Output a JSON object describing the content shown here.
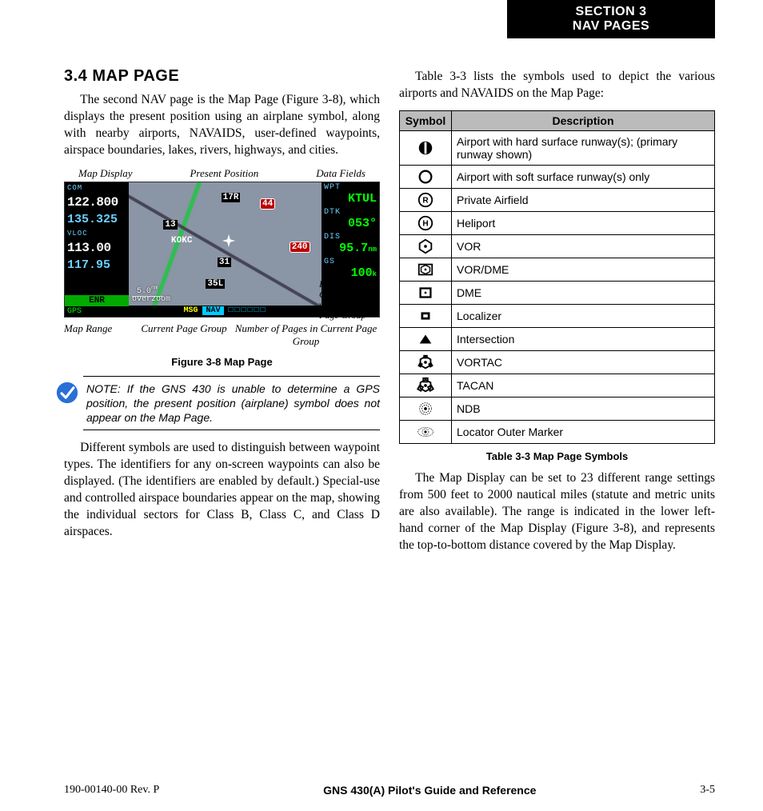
{
  "section_tab": {
    "line1": "SECTION 3",
    "line2": "NAV PAGES"
  },
  "heading": "3.4  MAP PAGE",
  "para1": "The second NAV page is the Map Page (Figure 3-8), which displays the present position using an airplane symbol, along with nearby airports, NAVAIDS, user-defined waypoints, airspace boundaries, lakes, rivers, highways, and cities.",
  "fig": {
    "top_callouts": {
      "c1": "Map Display",
      "c2": "Present Position",
      "c3": "Data Fields"
    },
    "side_callout": "Position of Current Page within Current Page Group",
    "bot_callouts": {
      "c1": "Map Range",
      "c2": "Current Page Group",
      "c3": "Number of Pages in Current Page Group"
    },
    "caption": "Figure 3-8  Map Page",
    "device": {
      "com_label": "COM",
      "com1": "122.800",
      "com2": "135.325",
      "vloc_label": "VLOC",
      "vloc1": "113.00",
      "vloc2": "117.95",
      "enr": "ENR",
      "gps": "GPS",
      "overzoom1": "5.0",
      "overzoom_unit": "nm",
      "overzoom2": "overzoom",
      "map_txt_17R": "17R",
      "map_txt_13": "13",
      "map_txt_KOKC": "KOKC",
      "map_txt_44": "44",
      "map_txt_240": "240",
      "map_txt_31": "31",
      "map_txt_35L": "35L",
      "wpt_label": "WPT",
      "wpt_val": "KTUL",
      "dtk_label": "DTK",
      "dtk_val": "053°",
      "dis_label": "DIS",
      "dis_val": "95.7",
      "dis_unit": "nm",
      "gs_label": "GS",
      "gs_val": "100",
      "gs_unit": "k",
      "msg": "MSG",
      "nav": "NAV",
      "page_boxes": "□□□□□□"
    }
  },
  "note": "NOTE:  If the GNS 430 is unable to determine a GPS position, the present position (airplane) symbol does not appear on the Map Page.",
  "para2": "Different symbols are used to distinguish between waypoint types.  The identifiers for any on-screen waypoints can also be displayed.  (The identifiers are enabled by default.)  Special-use and controlled airspace boundaries appear on the map, showing the individual sectors for Class B, Class C, and Class D airspaces.",
  "para3": "Table 3-3 lists the symbols used to depict the various airports and NAVAIDS on the Map Page:",
  "table": {
    "h1": "Symbol",
    "h2": "Description",
    "rows": [
      "Airport with hard surface runway(s); (primary runway shown)",
      "Airport with soft surface runway(s) only",
      "Private Airfield",
      "Heliport",
      "VOR",
      "VOR/DME",
      "DME",
      "Localizer",
      "Intersection",
      "VORTAC",
      "TACAN",
      "NDB",
      "Locator Outer Marker"
    ],
    "caption": "Table 3-3 Map Page Symbols"
  },
  "para4": "The Map Display can be set to 23 different range settings from 500 feet to 2000 nautical miles (statute and metric units are also available).  The range is indicated in the lower left-hand corner of the Map Display (Figure 3-8), and represents the top-to-bottom distance covered by the Map Display.",
  "footer": {
    "left": "190-00140-00  Rev. P",
    "center": "GNS 430(A) Pilot's Guide and Reference",
    "right": "3-5"
  }
}
